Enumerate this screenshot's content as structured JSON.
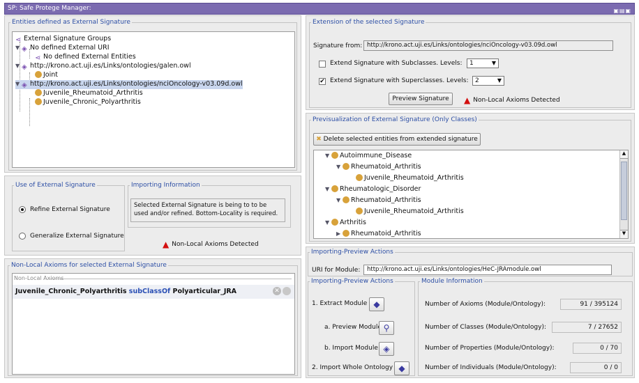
{
  "window": {
    "title": "SP: Safe Protege Manager:",
    "controls": "▣▤▣"
  },
  "left": {
    "groups_title": "Entities defined as External Signature",
    "tree": {
      "root": "External Signature Groups",
      "no_uri": "No defined External URI",
      "no_entities": "No defined External Entities",
      "galen_uri": "http://krono.act.uji.es/Links/ontologies/galen.owl",
      "joint": "Joint",
      "nci_uri": "http://krono.act.uji.es/Links/ontologies/nciOncology-v03.09d.owl",
      "jra": "Juvenile_Rheumatoid_Arthritis",
      "jcp": "Juvenile_Chronic_Polyarthritis"
    },
    "use_title": "Use of External Signature",
    "refine": "Refine External Signature",
    "generalize": "Generalize External Signature",
    "importing_title": "Importing Information",
    "importing_text": "Selected External Signature is being to to be used and/or refined. Bottom-Locality is required.",
    "warning": "Non-Local Axioms Detected",
    "nonlocal_title": "Non-Local Axioms for selected External Signature",
    "nonlocal_header": "Non-Local Axioms",
    "axiom": {
      "subject": "Juvenile_Chronic_Polyarthritis",
      "relation": "subClassOf",
      "object": "Polyarticular_JRA"
    }
  },
  "right": {
    "ext_title": "Extension of the selected Signature",
    "sig_from_label": "Signature from:",
    "sig_from_value": "http://krono.act.uji.es/Links/ontologies/nciOncology-v03.09d.owl",
    "sub_label": "Extend Signature with Subclasses. Levels:",
    "sub_level": "1",
    "super_label": "Extend Signature with Superclasses. Levels:",
    "super_level": "2",
    "preview_btn": "Preview Signature",
    "warning": "Non-Local Axioms Detected",
    "prev_title": "Previsualization of External Signature (Only Classes)",
    "delete_btn": "Delete selected entities from extended signature",
    "ptree": {
      "a": "Autoimmune_Disease",
      "b": "Rheumatoid_Arthritis",
      "c": "Juvenile_Rheumatoid_Arthritis",
      "d": "Rheumatologic_Disorder",
      "e": "Rheumatoid_Arthritis",
      "f": "Juvenile_Rheumatoid_Arthritis",
      "g": "Arthritis",
      "h": "Rheumatoid_Arthritis"
    },
    "ipa_title": "Importing-Preview Actions",
    "uri_label": "URI for Module:",
    "uri_value": "http://krono.act.uji.es/Links/ontologies/HeC-JRAmodule.owl",
    "ipa_inner_title": "Importing-Preview Actions",
    "extract": "1. Extract Module",
    "preview_module": "a. Preview Module",
    "import_module": "b. Import Module",
    "import_whole": "2. Import Whole Ontology",
    "modinfo_title": "Module Information",
    "axioms_label": "Number of Axioms (Module/Ontology):",
    "axioms_value": "91 / 395124",
    "classes_label": "Number of Classes (Module/Ontology):",
    "classes_value": "7 / 27652",
    "props_label": "Number of Properties (Module/Ontology):",
    "props_value": "0 / 70",
    "indiv_label": "Number of Individuals (Module/Ontology):",
    "indiv_value": "0 / 0"
  }
}
